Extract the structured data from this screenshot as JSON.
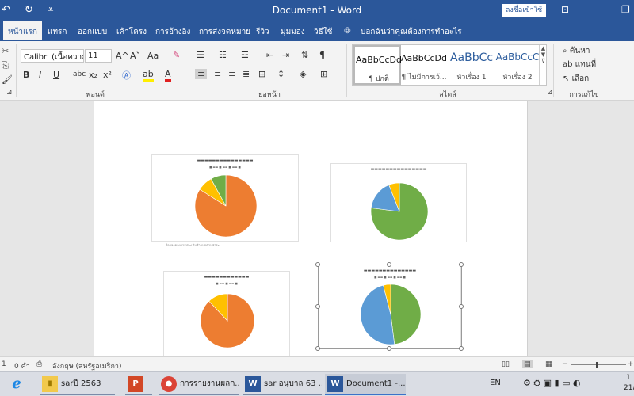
{
  "titlebar": {
    "undo_icon": "undo-icon",
    "redo_icon": "redo-icon",
    "title": "Document1 - Word",
    "signin": "ลงชื่อเข้าใช้"
  },
  "tabs": {
    "home": "หน้าแรก",
    "insert": "แทรก",
    "design": "ออกแบบ",
    "layout": "เค้าโครง",
    "references": "การอ้างอิง",
    "mailings": "การส่งจดหมาย",
    "review": "รีวิว",
    "view": "มุมมอง",
    "help": "วิธีใช้",
    "tellme": "บอกฉันว่าคุณต้องการทำอะไร"
  },
  "ribbon": {
    "font_name": "Calibri (เนื้อความ)",
    "font_size": "11",
    "font_group": "ฟอนต์",
    "paragraph_group": "ย่อหน้า",
    "styles_group": "สไตล์",
    "editing_group": "การแก้ไข",
    "bold": "B",
    "italic": "I",
    "underline": "U",
    "strike": "abc",
    "subscript": "x₂",
    "superscript": "x²",
    "grow_font": "A^",
    "shrink_font": "Aˇ",
    "change_case": "Aa",
    "find": "ค้นหา",
    "replace": "แทนที่",
    "select": "เลือก",
    "styles": [
      {
        "sample": "AaBbCcDd",
        "name": "¶ ปกติ"
      },
      {
        "sample": "AaBbCcDd",
        "name": "¶ ไม่มีการเว้..."
      },
      {
        "sample": "AaBbCc",
        "name": "หัวเรื่อง 1"
      },
      {
        "sample": "AaBbCcC",
        "name": "หัวเรื่อง 2"
      }
    ]
  },
  "document": {
    "caption": "ร้อยละของการประเมินจำแนกตามสาระ"
  },
  "chart_data": [
    {
      "type": "pie",
      "slices": [
        {
          "value": 0.84,
          "color": "#ed7d31"
        },
        {
          "value": 0.08,
          "color": "#ffc000"
        },
        {
          "value": 0.08,
          "color": "#70ad47"
        }
      ]
    },
    {
      "type": "pie",
      "slices": [
        {
          "value": 0.77,
          "color": "#70ad47"
        },
        {
          "value": 0.17,
          "color": "#5b9bd5"
        },
        {
          "value": 0.06,
          "color": "#ffc000"
        }
      ]
    },
    {
      "type": "pie",
      "slices": [
        {
          "value": 0.88,
          "color": "#ed7d31"
        },
        {
          "value": 0.12,
          "color": "#ffc000"
        }
      ]
    },
    {
      "type": "pie",
      "slices": [
        {
          "value": 0.48,
          "color": "#70ad47"
        },
        {
          "value": 0.48,
          "color": "#5b9bd5"
        },
        {
          "value": 0.04,
          "color": "#ffc000"
        }
      ]
    }
  ],
  "statusbar": {
    "page": "1",
    "words": "0 คำ",
    "language": "อังกฤษ (สหรัฐอเมริกา)",
    "zoom_minus": "−",
    "zoom_plus": "+"
  },
  "taskbar": {
    "items": [
      {
        "label": "sarปี 2563",
        "icon_text": "▮"
      },
      {
        "label": "การรายงานผลก...",
        "icon_text": "●"
      },
      {
        "label": "sar อนุบาล 63 ...",
        "icon_text": "W"
      },
      {
        "label": "Document1 -...",
        "icon_text": "W"
      }
    ],
    "lang": "EN",
    "time": "1",
    "date": "21/"
  }
}
